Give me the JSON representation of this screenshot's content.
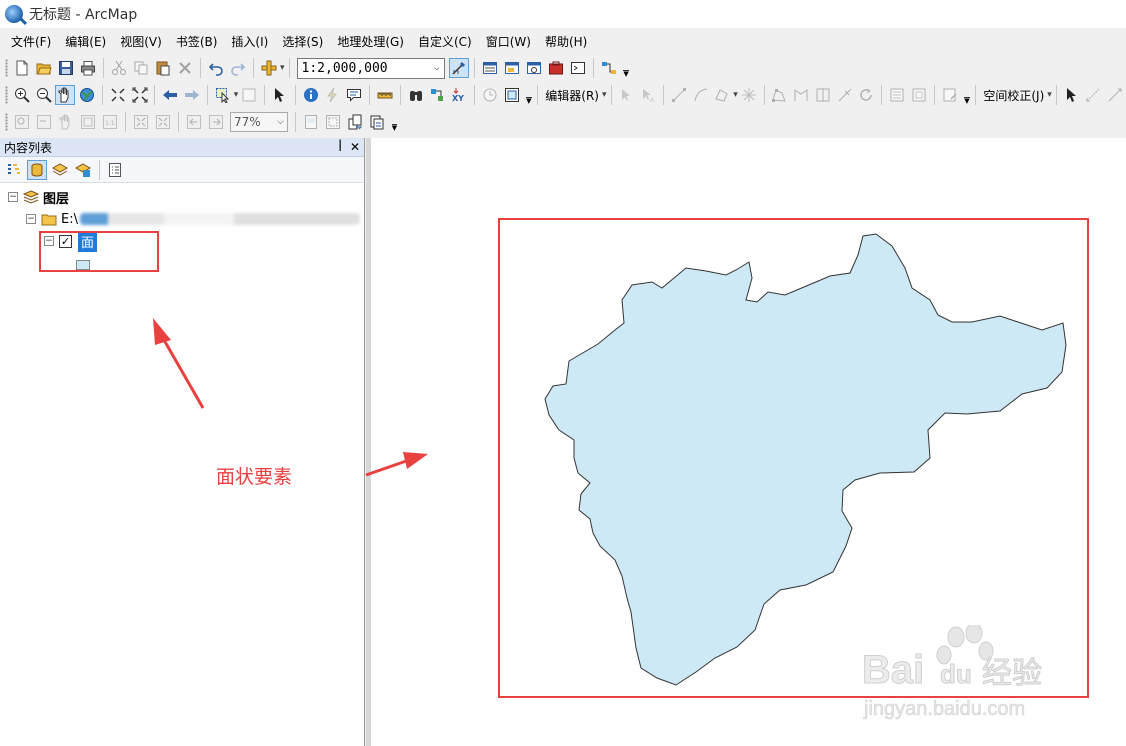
{
  "window": {
    "title": "无标题 - ArcMap"
  },
  "menu": [
    "文件(F)",
    "编辑(E)",
    "视图(V)",
    "书签(B)",
    "插入(I)",
    "选择(S)",
    "地理处理(G)",
    "自定义(C)",
    "窗口(W)",
    "帮助(H)"
  ],
  "toolbar": {
    "scale_value": "1:2,000,000",
    "zoom_value": "77%",
    "editor_label": "编辑器(R)",
    "spatial_adjust_label": "空间校正(J)"
  },
  "toc": {
    "title": "内容列表",
    "pin": "ᵖ",
    "close": "✕",
    "root_label": "图层",
    "folder_label": "E:\\",
    "layer_name": "面",
    "layer_checked": true
  },
  "annotation": {
    "label": "面状要素",
    "color": "#e94040"
  },
  "map": {
    "polygon_fill": "#cde9f6",
    "polygon_stroke": "#333333"
  },
  "watermark": {
    "brand": "Bai du 经验",
    "url": "jingyan.baidu.com"
  }
}
